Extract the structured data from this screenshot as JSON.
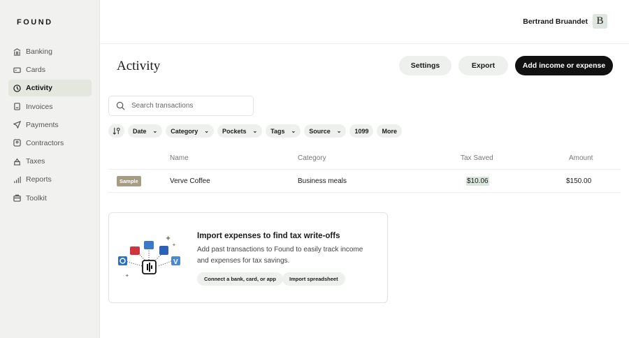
{
  "brand": "FOUND",
  "sidebar": {
    "items": [
      {
        "label": "Banking",
        "icon": "bank-icon"
      },
      {
        "label": "Cards",
        "icon": "card-icon"
      },
      {
        "label": "Activity",
        "icon": "clock-icon",
        "active": true
      },
      {
        "label": "Invoices",
        "icon": "invoice-icon"
      },
      {
        "label": "Payments",
        "icon": "send-icon"
      },
      {
        "label": "Contractors",
        "icon": "contractor-icon"
      },
      {
        "label": "Taxes",
        "icon": "government-icon"
      },
      {
        "label": "Reports",
        "icon": "bar-chart-icon"
      },
      {
        "label": "Toolkit",
        "icon": "briefcase-icon"
      }
    ]
  },
  "user": {
    "name": "Bertrand Bruandet",
    "initial": "B"
  },
  "page": {
    "title": "Activity",
    "settings": "Settings",
    "export": "Export",
    "add": "Add income or expense"
  },
  "search": {
    "placeholder": "Search transactions"
  },
  "filters": [
    "Date",
    "Category",
    "Pockets",
    "Tags",
    "Source",
    "1099",
    "More"
  ],
  "table": {
    "headers": {
      "name": "Name",
      "category": "Category",
      "tax": "Tax Saved",
      "amount": "Amount"
    },
    "rows": [
      {
        "badge": "Sample",
        "name": "Verve Coffee",
        "category": "Business meals",
        "tax": "$10.06",
        "amount": "$150.00"
      }
    ]
  },
  "import": {
    "title": "Import expenses to find tax write-offs",
    "body": "Add past transactions to Found to easily track income and expenses for tax savings.",
    "connect": "Connect a bank, card, or app",
    "spreadsheet": "Import spreadsheet"
  },
  "colors": {
    "accent": "#111111",
    "sidebar": "#f1f2ef",
    "badge": "#a49d83"
  }
}
